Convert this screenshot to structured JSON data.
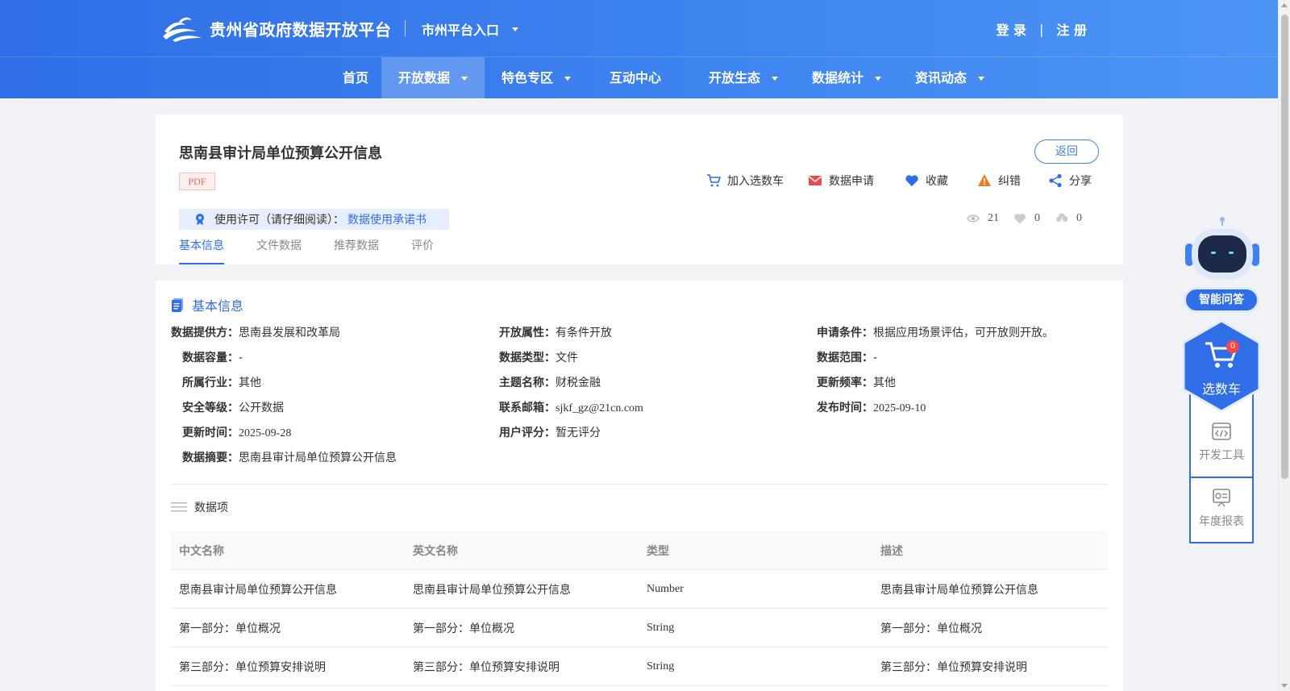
{
  "header": {
    "site_title": "贵州省政府数据开放平台",
    "city_entry": "市州平台入口",
    "login": "登 录",
    "separator": "|",
    "register": "注 册"
  },
  "nav": {
    "items": [
      {
        "label": "首页"
      },
      {
        "label": "开放数据"
      },
      {
        "label": "特色专区"
      },
      {
        "label": "互动中心"
      },
      {
        "label": "开放生态"
      },
      {
        "label": "数据统计"
      },
      {
        "label": "资讯动态"
      }
    ],
    "active_index": 1
  },
  "dataset": {
    "title": "思南县审计局单位预算公开信息",
    "format_tag": "PDF",
    "back_label": "返回",
    "actions": {
      "add_cart": "加入选数车",
      "apply": "数据申请",
      "favorite": "收藏",
      "report": "纠错",
      "share": "分享"
    },
    "license": {
      "label": "使用许可（请仔细阅读）：",
      "link": "数据使用承诺书"
    },
    "stats": {
      "views": "21",
      "likes": "0",
      "downloads": "0"
    },
    "tabs": [
      "基本信息",
      "文件数据",
      "推荐数据",
      "评价"
    ]
  },
  "basic_info": {
    "section_title": "基本信息",
    "fields": {
      "provider": {
        "label": "数据提供方：",
        "value": "思南县发展和改革局"
      },
      "open_attr": {
        "label": "开放属性：",
        "value": "有条件开放"
      },
      "apply_cond": {
        "label": "申请条件：",
        "value": "根据应用场景评估，可开放则开放。"
      },
      "capacity": {
        "label": "数据容量：",
        "value": "-"
      },
      "data_type": {
        "label": "数据类型：",
        "value": "文件"
      },
      "data_range": {
        "label": "数据范围：",
        "value": "-"
      },
      "industry": {
        "label": "所属行业：",
        "value": "其他"
      },
      "theme": {
        "label": "主题名称：",
        "value": "财税金融"
      },
      "frequency": {
        "label": "更新频率：",
        "value": "其他"
      },
      "security": {
        "label": "安全等级：",
        "value": "公开数据"
      },
      "email": {
        "label": "联系邮箱：",
        "value": "sjkf_gz@21cn.com"
      },
      "publish_time": {
        "label": "发布时间：",
        "value": "2025-09-10"
      },
      "update_time": {
        "label": "更新时间：",
        "value": "2025-09-28"
      },
      "rating": {
        "label": "用户评分：",
        "value": "暂无评分"
      },
      "summary": {
        "label": "数据摘要：",
        "value": "思南县审计局单位预算公开信息"
      }
    }
  },
  "data_items": {
    "title": "数据项",
    "headers": [
      "中文名称",
      "英文名称",
      "类型",
      "描述"
    ],
    "rows": [
      [
        "思南县审计局单位预算公开信息",
        "思南县审计局单位预算公开信息",
        "Number",
        "思南县审计局单位预算公开信息"
      ],
      [
        "第一部分：单位概况",
        "第一部分：单位概况",
        "String",
        "第一部分：单位概况"
      ],
      [
        "第三部分：单位预算安排说明",
        "第三部分：单位预算安排说明",
        "String",
        "第三部分：单位预算安排说明"
      ]
    ]
  },
  "side": {
    "ask": "智能问答",
    "cart": "选数车",
    "cart_count": "0",
    "dev_tools": "开发工具",
    "annual_report": "年度报表"
  },
  "colors": {
    "primary": "#2f6ee6",
    "header_gradient_end": "#4d94f5",
    "danger": "#ff4444",
    "warning": "#f07b1f"
  }
}
